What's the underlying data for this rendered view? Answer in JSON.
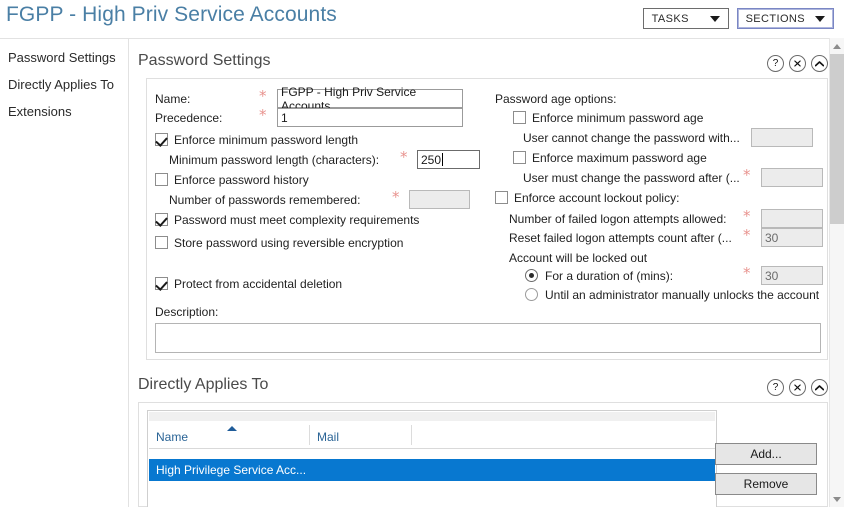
{
  "window": {
    "title": "FGPP - High Priv Service Accounts"
  },
  "toolbar": {
    "tasks_label": "TASKS",
    "sections_label": "SECTIONS"
  },
  "sidebar": {
    "items": [
      {
        "label": "Password Settings"
      },
      {
        "label": "Directly Applies To"
      },
      {
        "label": "Extensions"
      }
    ]
  },
  "icons": {
    "help": "?",
    "close": "close-icon",
    "collapse": "chevron-up-icon",
    "required": "*"
  },
  "password_settings": {
    "title": "Password Settings",
    "name": {
      "label": "Name:",
      "value": "FGPP - High Priv Service Accounts",
      "required": true
    },
    "precedence": {
      "label": "Precedence:",
      "value": "1",
      "required": true
    },
    "enforce_min_length": {
      "label": "Enforce minimum password length",
      "checked": true
    },
    "min_length": {
      "label": "Minimum password length (characters):",
      "value": "250",
      "required": true,
      "focused": true
    },
    "enforce_history": {
      "label": "Enforce password history",
      "checked": false
    },
    "passwords_remembered": {
      "label": "Number of passwords remembered:",
      "value": "",
      "required": true,
      "disabled": true
    },
    "complexity": {
      "label": "Password must meet complexity requirements",
      "checked": true
    },
    "reversible_encryption": {
      "label": "Store password using reversible encryption",
      "checked": false
    },
    "protect_deletion": {
      "label": "Protect from accidental deletion",
      "checked": true
    },
    "description": {
      "label": "Description:",
      "value": ""
    },
    "age_options": {
      "title": "Password age options:",
      "enforce_min_age": {
        "label": "Enforce minimum password age",
        "checked": false
      },
      "min_age_value": {
        "label": "User cannot change the password with...",
        "value": "",
        "required": true,
        "disabled": true
      },
      "enforce_max_age": {
        "label": "Enforce maximum password age",
        "checked": false
      },
      "max_age_value": {
        "label": "User must change the password after (...",
        "value": "",
        "required": true,
        "disabled": true
      }
    },
    "lockout": {
      "enforce": {
        "label": "Enforce account lockout policy:",
        "checked": false
      },
      "failed_attempts": {
        "label": "Number of failed logon attempts allowed:",
        "value": "",
        "required": true,
        "disabled": true
      },
      "reset_count": {
        "label": "Reset failed logon attempts count after (...",
        "value": "30",
        "required": true,
        "disabled": true
      },
      "locked_out_label": "Account will be locked out",
      "duration_option": {
        "label": "For a duration of (mins):",
        "selected": true,
        "value": "30",
        "required": true,
        "disabled": true
      },
      "manual_option": {
        "label": "Until an administrator manually unlocks the account",
        "selected": false
      }
    }
  },
  "directly_applies_to": {
    "title": "Directly Applies To",
    "columns": [
      "Name",
      "Mail"
    ],
    "sort_column": "Name",
    "sort_direction": "ascending",
    "rows": [
      {
        "name": "High Privilege Service Acc...",
        "mail": "",
        "selected": true
      }
    ],
    "buttons": {
      "add": "Add...",
      "remove": "Remove"
    }
  },
  "colors": {
    "title_blue": "#4a7fa5",
    "selection_blue": "#0878d0",
    "column_header_blue": "#2a6496",
    "required_asterisk": "#e8938f"
  }
}
